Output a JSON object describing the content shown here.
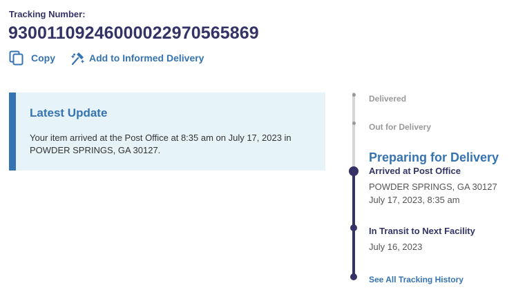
{
  "tracking": {
    "label": "Tracking Number:",
    "number": "9300110924600002297056586 9"
  },
  "actions": {
    "copy_label": "Copy",
    "informed_delivery_label": "Add to Informed Delivery",
    "copy_icon": "copy-icon",
    "informed_delivery_icon": "informed-delivery-icon"
  },
  "latest_update": {
    "title": "Latest Update",
    "body": "Your item arrived at the Post Office at 8:35 am on July 17, 2023 in POWDER SPRINGS, GA 30127."
  },
  "timeline": {
    "stages": {
      "delivered": "Delivered",
      "out_for_delivery": "Out for Delivery",
      "current": "Preparing for Delivery"
    },
    "events": [
      {
        "title": "Arrived at Post Office",
        "location": "POWDER SPRINGS, GA 30127",
        "datetime": "July 17, 2023, 8:35 am"
      },
      {
        "title": "In Transit to Next Facility",
        "datetime": "July 16, 2023"
      }
    ],
    "see_all_label": "See All Tracking History"
  },
  "colors": {
    "navy": "#333366",
    "link_blue": "#3573b1",
    "card_bg": "#e6f3f9",
    "muted_gray": "#999999"
  }
}
